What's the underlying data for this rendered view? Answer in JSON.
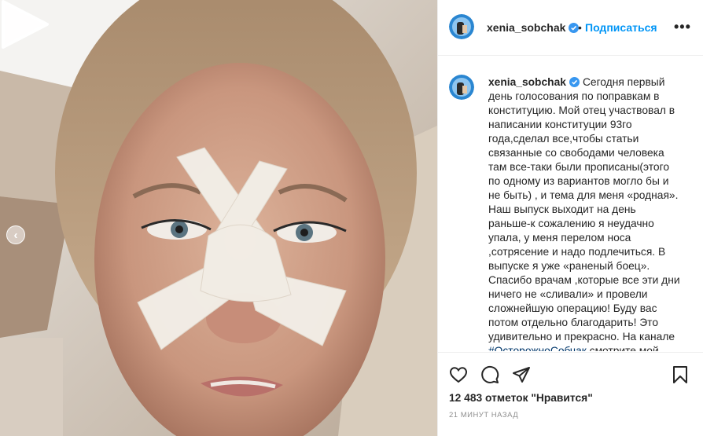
{
  "post": {
    "username": "xenia_sobchak",
    "follow_label": "Подписаться",
    "dot": "•",
    "more_label": "•••",
    "caption_text": "Сегодня первый день голосования по поправкам в конституцию. Мой отец участвовал в написании конституции 93го года,сделал все,чтобы статьи связанные со свободами человека там все-таки были прописаны(этого по одному из вариантов могло бы и не быть) , и тема для меня «родная». Наш выпуск выходит на день раньше-к сожалению я неудачно упала, у меня перелом носа ,сотрясение и надо подлечиться. В выпуске я уже «раненый боец». Спасибо врачам ,которые все эти дни ничего не «сливали» и провели сложнейшую операцию! Буду вас потом отдельно благодарить! Это удивительно и прекрасно. На канале ",
    "caption_tag": "#ОсторожноСобчак",
    "caption_tail": " смотрите мой",
    "likes_count": "12 483",
    "likes_label": "отметок \"Нравится\"",
    "time_ago": "21 минут назад"
  },
  "media": {
    "type": "video",
    "prev_arrow": "‹"
  },
  "icons": {
    "verified": "verified-badge-icon",
    "like": "heart-icon",
    "comment": "comment-icon",
    "share": "paper-plane-icon",
    "save": "bookmark-icon",
    "play": "play-icon",
    "prev": "chevron-left-icon"
  },
  "colors": {
    "link_blue": "#0095f6",
    "hashtag": "#00376b",
    "muted": "#8e8e8e",
    "text": "#262626"
  }
}
